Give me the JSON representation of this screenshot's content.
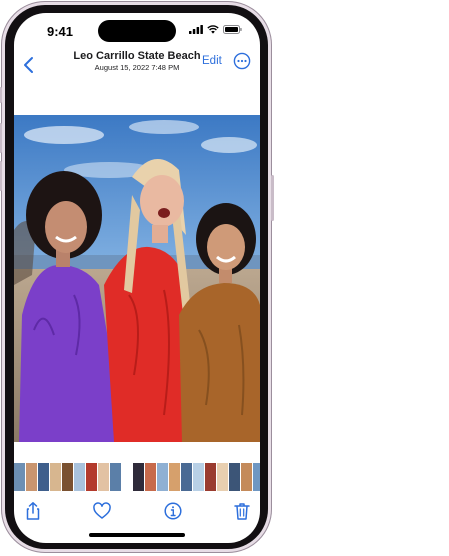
{
  "status_bar": {
    "time": "9:41",
    "icons": [
      "cellular-signal-icon",
      "wifi-icon",
      "battery-icon"
    ]
  },
  "nav": {
    "back_icon": "chevron-left-icon",
    "title": "Leo Carrillo State Beach",
    "subtitle": "August 15, 2022  7:48 PM",
    "edit_label": "Edit",
    "more_icon": "ellipsis-circle-icon"
  },
  "photo": {
    "subject": "photo-three-friends-beach"
  },
  "filmstrip": {
    "thumb_colors": [
      "#6d8fb3",
      "#c9956f",
      "#3f5f8c",
      "#d7b68f",
      "#7a5130",
      "#a9c2dc",
      "#b33a2c",
      "#e2c2a3",
      "#5b7fa8",
      "#2f2b3a",
      "#c76a4b",
      "#8fb0d3",
      "#d6a06c",
      "#4a6a94",
      "#b8d0e6",
      "#9a3b2f",
      "#e8cfb0",
      "#3c5577",
      "#c48a5a",
      "#6f97c2",
      "#e04a3a",
      "#a37a55",
      "#2e4e78",
      "#d8b291"
    ]
  },
  "toolbar": {
    "items": [
      "share-icon",
      "heart-icon",
      "info-icon",
      "trash-icon"
    ]
  },
  "accent_color": "#2d6fdc"
}
